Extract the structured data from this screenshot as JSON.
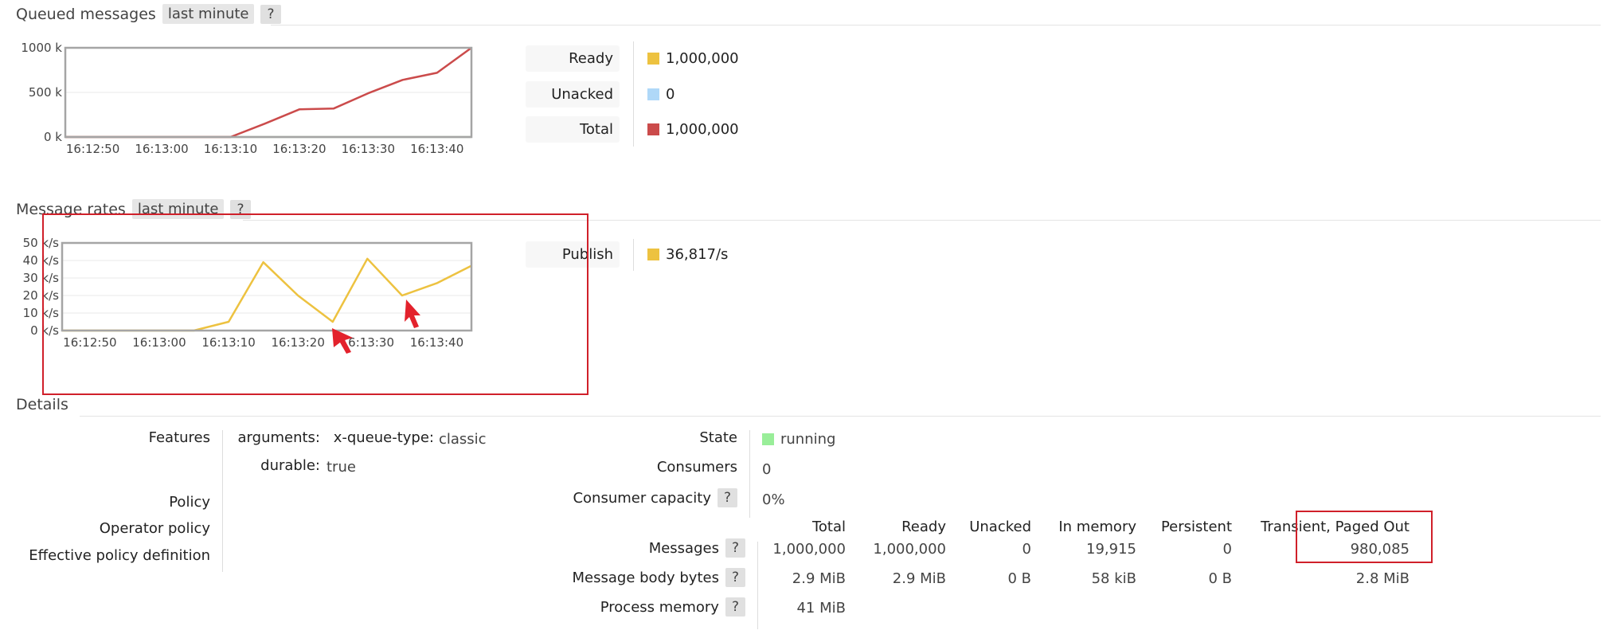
{
  "queued": {
    "title": "Queued messages",
    "range": "last minute",
    "help": "?",
    "y_ticks": [
      "1000 k",
      "500 k",
      "0 k"
    ],
    "x_ticks": [
      "16:12:50",
      "16:13:00",
      "16:13:10",
      "16:13:20",
      "16:13:30",
      "16:13:40"
    ],
    "legend": [
      {
        "label": "Ready",
        "value": "1,000,000",
        "color": "#edc240"
      },
      {
        "label": "Unacked",
        "value": "0",
        "color": "#afd8f8"
      },
      {
        "label": "Total",
        "value": "1,000,000",
        "color": "#cb4b4b"
      }
    ]
  },
  "rates": {
    "title": "Message rates",
    "range": "last minute",
    "help": "?",
    "y_ticks": [
      "50 k/s",
      "40 k/s",
      "30 k/s",
      "20 k/s",
      "10 k/s",
      "0 k/s"
    ],
    "x_ticks": [
      "16:12:50",
      "16:13:00",
      "16:13:10",
      "16:13:20",
      "16:13:30",
      "16:13:40"
    ],
    "legend": [
      {
        "label": "Publish",
        "value": "36,817/s",
        "color": "#edc240"
      }
    ]
  },
  "details": {
    "title": "Details",
    "features_label": "Features",
    "arguments_label": "arguments:",
    "arg_key": "x-queue-type:",
    "arg_value": "classic",
    "durable_label": "durable:",
    "durable_value": "true",
    "policy_label": "Policy",
    "operator_policy_label": "Operator policy",
    "effective_policy_label": "Effective policy definition",
    "state_label": "State",
    "state_value": "running",
    "state_color": "#99ee99",
    "consumers_label": "Consumers",
    "consumers_value": "0",
    "consumer_capacity_label": "Consumer capacity",
    "consumer_capacity_value": "0%",
    "help": "?",
    "table": {
      "headers": [
        "Total",
        "Ready",
        "Unacked",
        "In memory",
        "Persistent",
        "Transient, Paged Out"
      ],
      "rows": [
        {
          "label": "Messages",
          "values": [
            "1,000,000",
            "1,000,000",
            "0",
            "19,915",
            "0",
            "980,085"
          ]
        },
        {
          "label": "Message body bytes",
          "values": [
            "2.9 MiB",
            "2.9 MiB",
            "0 B",
            "58 kiB",
            "0 B",
            "2.8 MiB"
          ]
        },
        {
          "label": "Process memory",
          "values": [
            "41 MiB"
          ]
        }
      ]
    }
  },
  "chart_data": [
    {
      "type": "line",
      "title": "Queued messages",
      "x": [
        "16:12:46",
        "16:12:50",
        "16:12:55",
        "16:13:00",
        "16:13:05",
        "16:13:10",
        "16:13:15",
        "16:13:20",
        "16:13:25",
        "16:13:30",
        "16:13:35",
        "16:13:40",
        "16:13:45"
      ],
      "series": [
        {
          "name": "Ready",
          "color": "#edc240",
          "values": [
            0,
            0,
            0,
            0,
            0,
            0,
            0,
            0,
            0,
            0,
            0,
            0,
            0
          ]
        },
        {
          "name": "Unacked",
          "color": "#afd8f8",
          "values": [
            0,
            0,
            0,
            0,
            0,
            0,
            0,
            0,
            0,
            0,
            0,
            0,
            0
          ]
        },
        {
          "name": "Total",
          "color": "#cb4b4b",
          "values": [
            0,
            0,
            0,
            0,
            0,
            0,
            150,
            310,
            320,
            490,
            640,
            720,
            1000
          ]
        }
      ],
      "ylabel": "k",
      "ylim": [
        0,
        1000
      ],
      "grid": true
    },
    {
      "type": "line",
      "title": "Message rates",
      "x": [
        "16:12:46",
        "16:12:50",
        "16:12:55",
        "16:13:00",
        "16:13:05",
        "16:13:10",
        "16:13:15",
        "16:13:20",
        "16:13:25",
        "16:13:30",
        "16:13:35",
        "16:13:40",
        "16:13:45"
      ],
      "series": [
        {
          "name": "Publish",
          "color": "#edc240",
          "values": [
            0,
            0,
            0,
            0,
            0,
            5,
            39,
            20,
            5,
            41,
            20,
            27,
            37
          ]
        }
      ],
      "ylabel": "k/s",
      "ylim": [
        0,
        50
      ],
      "grid": true
    }
  ]
}
